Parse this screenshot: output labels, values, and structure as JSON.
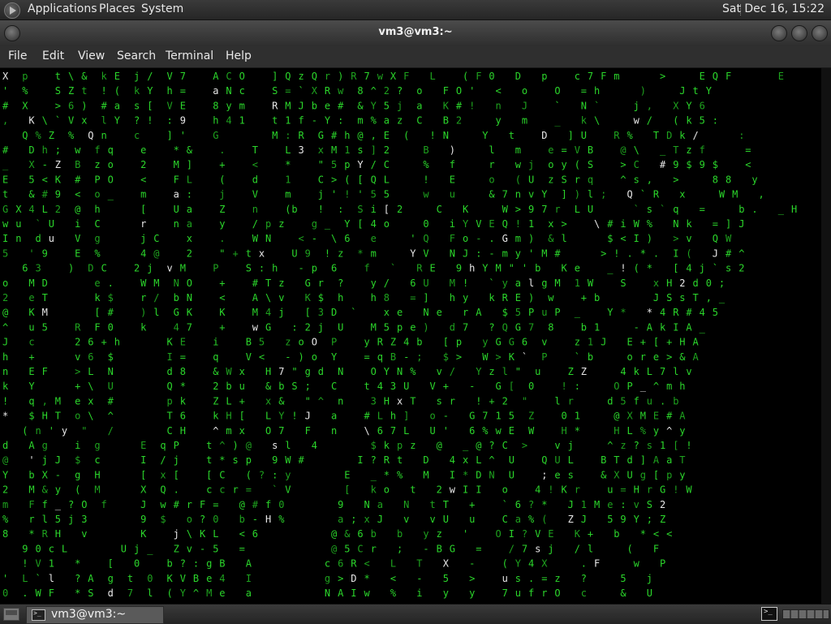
{
  "top_panel": {
    "menus": [
      "Applications",
      "Places",
      "System"
    ],
    "clock": "Sat Dec 16, 15:22"
  },
  "window": {
    "title": "vm3@vm3:~",
    "menu": [
      "File",
      "Edit",
      "View",
      "Search",
      "Terminal",
      "Help"
    ]
  },
  "taskbar": {
    "task_label": "vm3@vm3:~"
  },
  "terminal": {
    "program": "cmatrix",
    "colors": {
      "green": "#2bd62b",
      "dim_green": "#1ea31e",
      "white": "#e8e8e8",
      "background": "#000000"
    },
    "rows": [
      "X  p    t \\ &  k E  j /  V 7    A C O    ] Q z Q r ) R 7 w X F   L    ( F 0   D   p    c 7 F m      >     E Q F       E",
      "'  %    S Z t  ! (  k Y  h =    a N c    S = ` X R w  8 ^ 2 ?  o   F O '   <   o    O   = h      )     J t Y",
      "#  X    > 6 )  # a  s [  V E    8 y m    R M J b e #  & Y 5 j  a   K # !   n   J    `   N `     j ,   X Y 6",
      ",   K \\ ` V x  l Y  ? !  : 9    h 4 1    t 1 f - Y :  m % a z  C   B 2     y   m    _   k \\     w /   ( k 5 :",
      "   Q % Z  %  Q n    c    ] '    G        M : R  G # h @ , E  (   ! N     Y   t    D   ] U    R %   T D k /      :",
      "#   D h ;  w  f q    e    * &    .    T    L 3  x M 1 s ] 2     B   )     l   m    e = V B    @ \\   _ T z f      =",
      "_   X - Z  B  z o    2    M ]    +    <    *    \" 5 p Y / C     %   f     r   w j  o y ( S    > C   # 9 $ 9 $    <",
      "E   5 < K  #  P O    <    F L    (    d    1    C > ( [ Q L     !   E     o   ( U  z S r q    ^ s ,   >     8 8   y",
      "t   & # 9  <  o _    m    a :    j    V    m    j ' ! ' 5 5     w   u     & 7 n v Y  ] ) l ;   Q ` R   x     W M   ,",
      "G X 4 L 2  @  h      [    U a    Z    n    (b   !  :  S i [ 2     C   K     W > 9 7 r  L U      ` s ` q   =     b .   _ H",
      "w u  ` U   i  C      r    n a    y    / p z    g _  Y [ 4 o     0   i Y V E Q ! 1  x >    \\ # i W %   N k   = ] J",
      "I n  d u   V  g      j C    x    .    W N    < -  \\ 6   e     ' Q   F o - . G m )  & l      $ < I )   > v   Q W",
      "5   ' 9    E  %      4 @    2    \" + t x    U 9  ! z  * m     Y V   N J : - m y ' M #      > ! . * .  I (   J # ^",
      "   6 3    )  D C    2 j  v M    P    S : h   - p  6    f   `   R E   9 h Y M \" ' b   K e    _ ! ( *   [ 4 j ` s 2",
      "o   M D       e .    W M  N O    +    # T z   G r  ?    y /   6 U   M !   ` y a l g M  1 W    S    x H 2 d 0 ;",
      "2   e T       k $    r /  b N    <    A \\ v   K $  h    h 8   = ]   h y   k R E )  w    + b        J S s T , _",
      "@   K M       [ #    ) l  G K    K    M 4 j   [ 3 D  `    x e   N e   r A   $ 5 P u P  _    Y *   * 4 R # 4 5",
      "^   u 5    R  F 0    k    4 7    +    w G   : 2 j  U    M 5 p e )   d 7   ? Q G 7  8    b 1     - A k I A _",
      "J   c      2 6 + h       K E    i    B 5   z o O  P    y R Z 4 b   [ p   y G G 6  v    z 1 J   E + [ + H A",
      "h   +      v 6  $        I =    q    V <   - ) o  Y    = q B - ;   $ >   W > K `  P    ` b     o r e > & A",
      "n   E F    > L  N        d 8    & W x   H 7 \" g d  N    O Y N %   v /   Y z l \"  u    Z Z     4 k L 7 l v",
      "k   Y      + \\  U        Q *    2 b u   & b S ;   C    t 4 3 U   V +   -   G [  0    ! :     O P _ ^ m h",
      "!   q , M  e x  #        p k    Z L +   x &   \" ^  n    3 H x T   s r   ! + 2  \"    l r     d 5 f u . b",
      "*   $ H T  o \\  ^        T 6    k H [   L Y ! J   a    # L h ]   o -   G 7 1 5  Z    0 1     @ X M E # A",
      "   ( n ' y  \"   /        C H    ^ m x   O 7   F   n    \\ 6 7 L   U '   6 % w E  W    H *     H L % y ^ y",
      "d   A g    i  g      E  q P    t ^ ) @   s l   4        $ k p z   @   _ @ ? C  >    v j     ^ z ? s 1 [ !",
      "@   ' j J  $  c      I  / j    t * s p   9 W #        I ? R t   D   4 x L ^  U    Q U L    B T d ] A a T",
      "Y   b X -  g  H      [  x [    [ C   ( ? : y        E   _ * %   M   I * D N  U    ; e s    & X U g [ p y",
      "2   M & y  (  M      X  Q .    c c r =   ` V        [   k o   t   2 w I I   o    4 ! K r    u = H r G ! W",
      "m   F f _ ? O  f     J  w # r F =   @ # f 0        9   N a   N   t T   +    ` 6 ? *   J 1 M e : v S 2",
      "%   r l 5 j 3        9  $   o ? 0   b - H %        a ; x J   v   v U   u    C a % (   Z J   5 9 Y ; Z",
      "8   * R H   v        K    j \\ K L   < 6           @ & 6 b   b   y z   '    O I ? V E   K +   b   * < <",
      "   9 0 c L        U j _   Z v - 5   =             @ 5 C r   ;   - B G   =    / 7 s j   / l     (   F",
      "   ! V 1   *    [   0    b ? : g B   A           c 6 R <   L   T   X   -    ( Y 4 X     . F     w   P",
      "'  L ` l   ? A  g  t  0  K V B e 4   I           g > D *   <   -   5   >    u s . = z   ?     5   j",
      "0  . W F   * S  d  7  l  ( Y ^ M e   a           N A I w   %   i   y   y    7 u f r O   c     &   U"
    ]
  }
}
